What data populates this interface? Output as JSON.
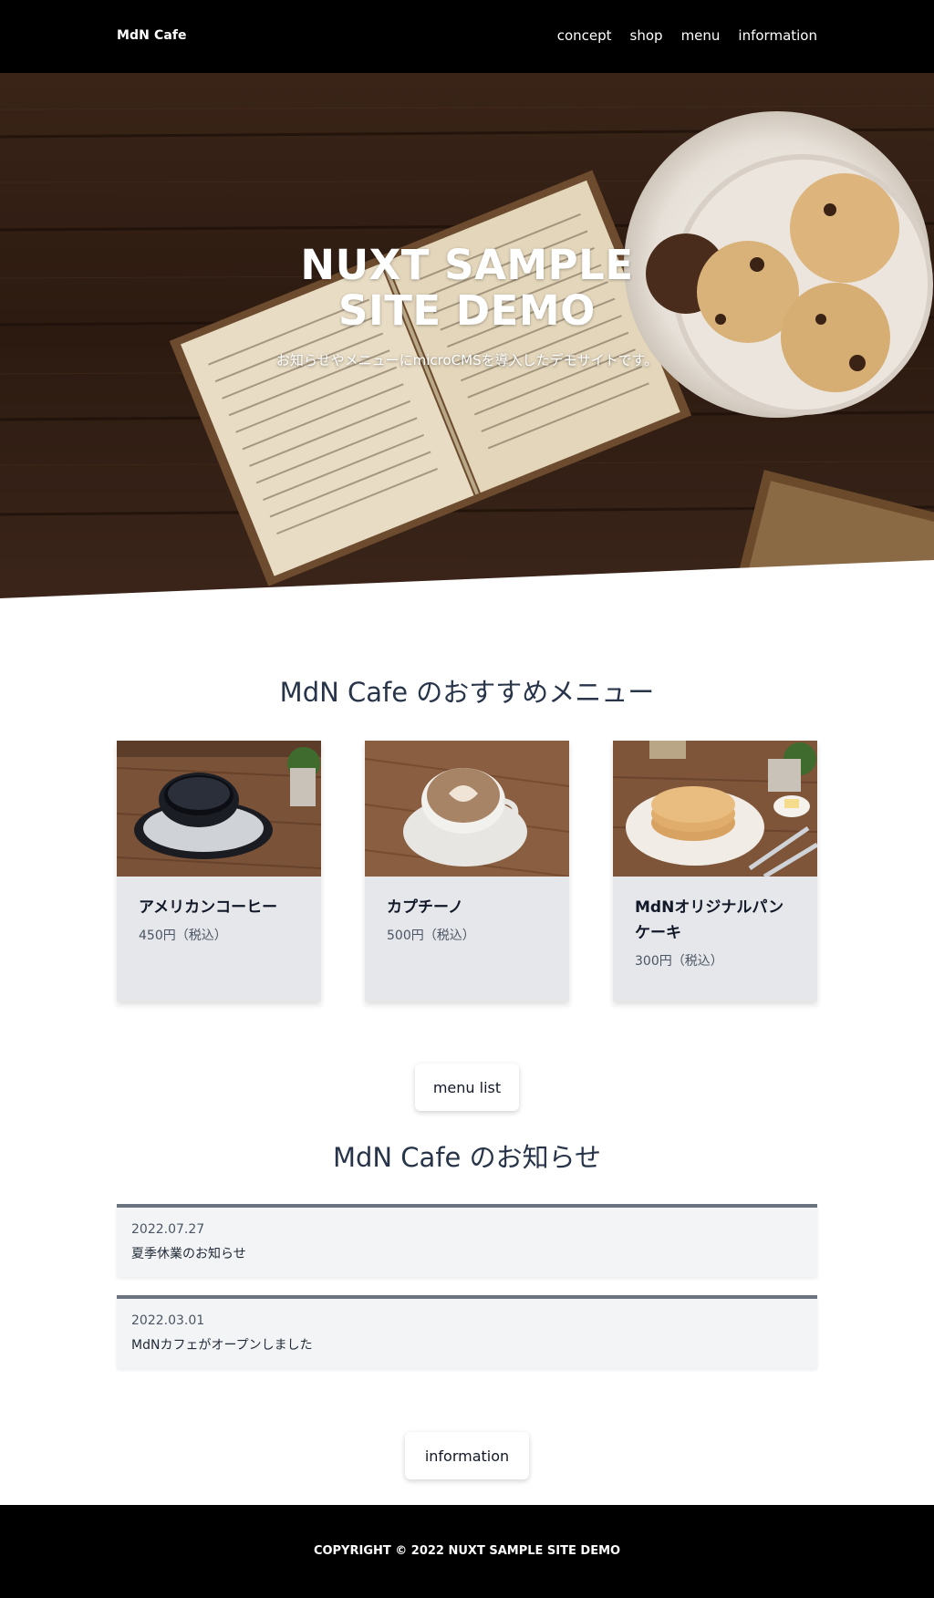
{
  "header": {
    "brand": "MdN Cafe",
    "nav": [
      "concept",
      "shop",
      "menu",
      "information"
    ]
  },
  "hero": {
    "title": "NUXT SAMPLE SITE DEMO",
    "subtitle": "お知らせやメニューにmicroCMSを導入したデモサイトです。"
  },
  "menu_section": {
    "title": "MdN Cafe のおすすめメニュー",
    "items": [
      {
        "name": "アメリカンコーヒー",
        "price": "450円（税込）",
        "image": "coffee-cup-photo"
      },
      {
        "name": "カプチーノ",
        "price": "500円（税込）",
        "image": "cappuccino-photo"
      },
      {
        "name": "MdNオリジナルパンケーキ",
        "price": "300円（税込）",
        "image": "pancake-photo"
      }
    ],
    "button_label": "menu list"
  },
  "news_section": {
    "title": "MdN Cafe のお知らせ",
    "items": [
      {
        "date": "2022.07.27",
        "title": "夏季休業のお知らせ"
      },
      {
        "date": "2022.03.01",
        "title": "MdNカフェがオープンしました"
      }
    ],
    "button_label": "information"
  },
  "footer": {
    "copyright": "COPYRIGHT © 2022 NUXT SAMPLE SITE DEMO"
  },
  "colors": {
    "header_bg": "#000000",
    "card_bg": "#e5e7eb",
    "news_bg": "#f3f4f6",
    "news_border": "#6b7280",
    "title_text": "#273449"
  }
}
